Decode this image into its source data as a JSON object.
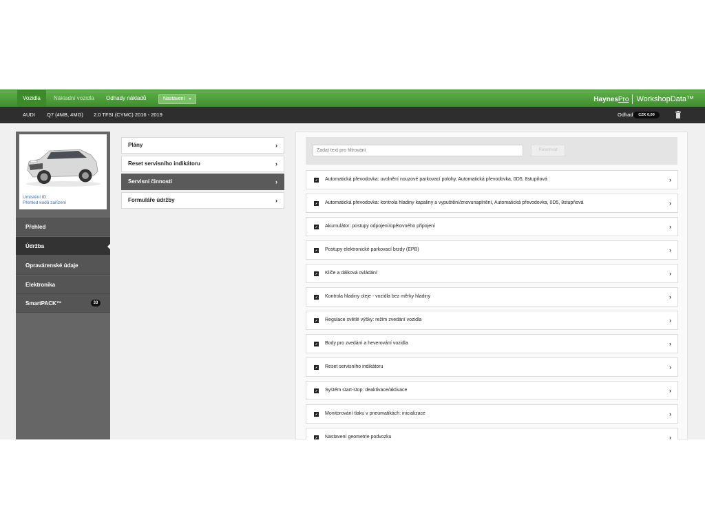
{
  "topnav": {
    "tabs": [
      "Vozidla",
      "Nákladní vozidla",
      "Odhady nákladů"
    ],
    "settings_label": "Nastavení",
    "logo_haynes": "Haynes",
    "logo_pro": "Pro",
    "logo_product": "WorkshopData™"
  },
  "vehicle": {
    "make": "AUDI",
    "model": "Q7 (4MB, 4MG)",
    "engine": "2.0 TFSI (CYMC) 2016 - 2019",
    "estimate_label": "Odhad",
    "estimate_value": "CZK 0,00"
  },
  "left": {
    "links": [
      "Umístění ID",
      "Přehled kódů zařízení"
    ],
    "menu": [
      {
        "label": "Přehled"
      },
      {
        "label": "Údržba"
      },
      {
        "label": "Opravárenské údaje"
      },
      {
        "label": "Elektronika"
      },
      {
        "label": "SmartPACK™",
        "badge": "33"
      }
    ]
  },
  "middle": {
    "items": [
      "Plány",
      "Reset servisního indikátoru",
      "Servisní činnosti",
      "Formuláře údržby"
    ]
  },
  "filter": {
    "placeholder": "Zadat text pro filtrování",
    "button": "Resetovat"
  },
  "tasks": [
    "Automatická převodovka: uvolnění nouzové parkovací polohy, Automatická převodovka, 0D5, 8stupňová",
    "Automatická převodovka: kontrola hladiny kapaliny a vypuštění/znovunaplnění, Automatická převodovka, 0D5, 8stupňová",
    "Akumulátor: postupy odpojení/opětovného připojení",
    "Postupy elektronické parkovací brzdy (EPB)",
    "Klíče a dálková ovládání",
    "Kontrola hladiny oleje - vozidla bez měrky hladiny",
    "Regulace světlé výšky: režim zvedání vozidla",
    "Body pro zvedání a heverování vozidla",
    "Reset servisního indikátoru",
    "Systém start-stop: deaktivace/aktivace",
    "Monitorování tlaku v pneumatikách: inicializace",
    "Nastavení geometrie podvozku"
  ]
}
